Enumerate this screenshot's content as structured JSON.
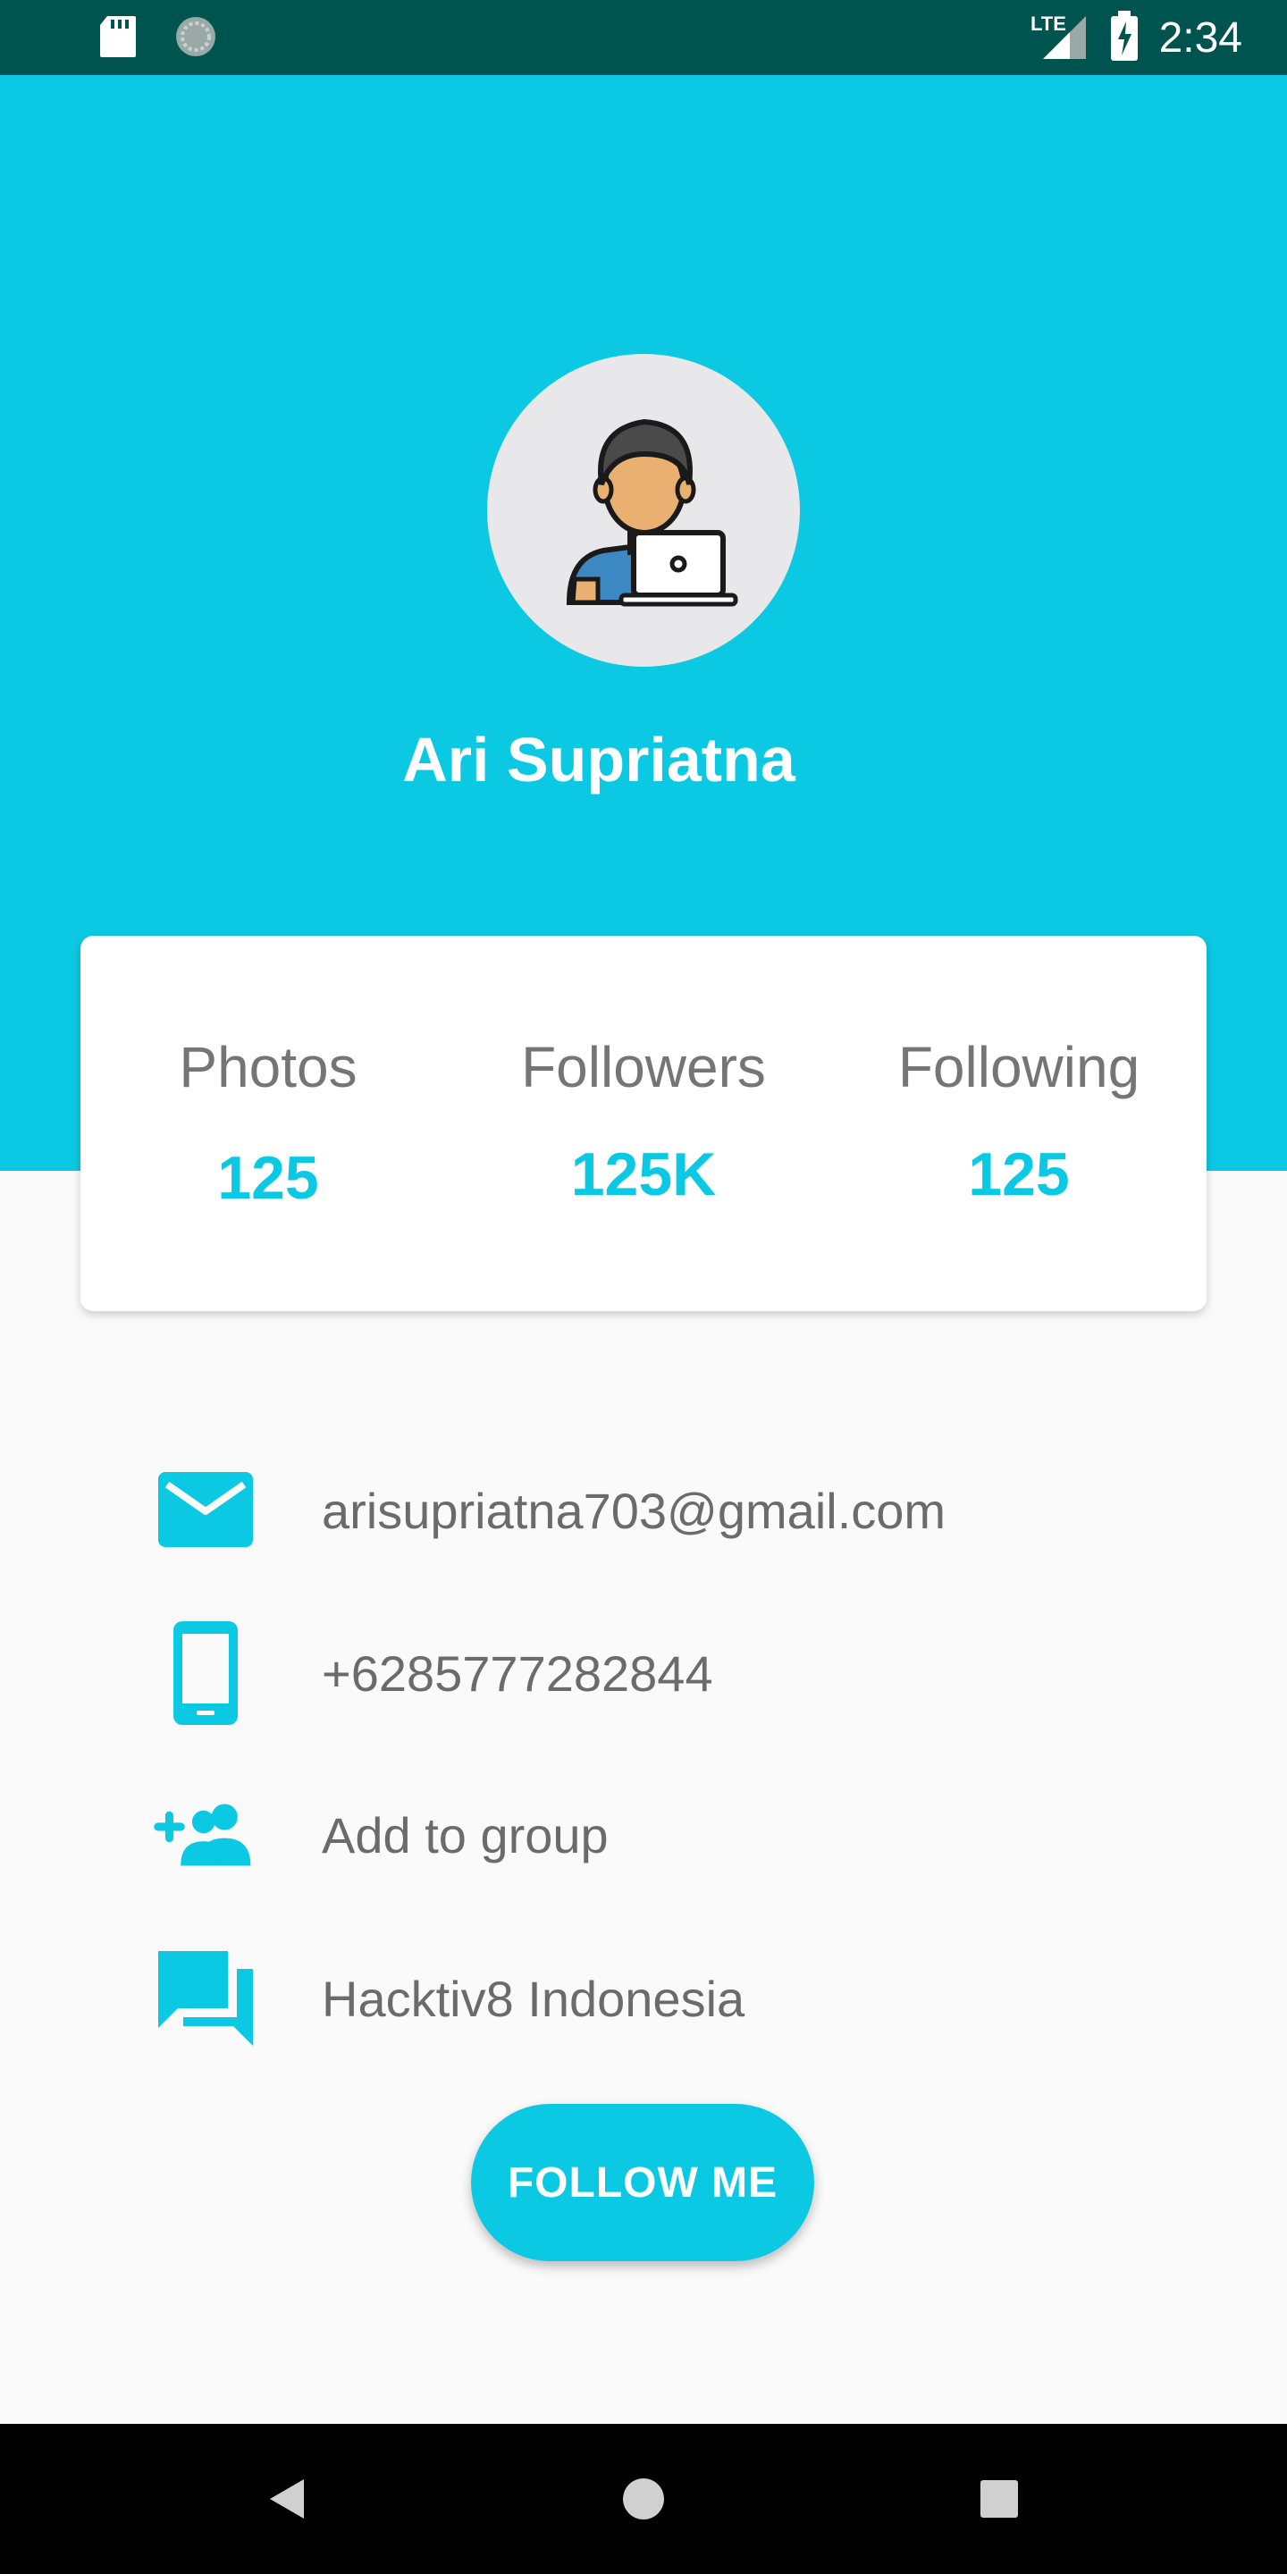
{
  "status_bar": {
    "time": "2:34",
    "network": "LTE",
    "icons": [
      "sd-card-icon",
      "sync-icon",
      "signal-icon",
      "battery-charging-icon"
    ]
  },
  "profile": {
    "name": "Ari Supriatna",
    "avatar_icon": "person-with-laptop-icon"
  },
  "stats": [
    {
      "label": "Photos",
      "value": "125"
    },
    {
      "label": "Followers",
      "value": "125K"
    },
    {
      "label": "Following",
      "value": "125"
    }
  ],
  "info": {
    "email": "arisupriatna703@gmail.com",
    "phone": "+6285777282844",
    "group": "Add to group",
    "company": "Hacktiv8 Indonesia"
  },
  "follow_button": "FOLLOW ME",
  "colors": {
    "accent": "#0bc8e3",
    "status_bar": "#00544f",
    "background": "#fafafa",
    "text_gray": "#757575"
  },
  "nav_bar": [
    "back-icon",
    "home-icon",
    "recents-icon"
  ]
}
